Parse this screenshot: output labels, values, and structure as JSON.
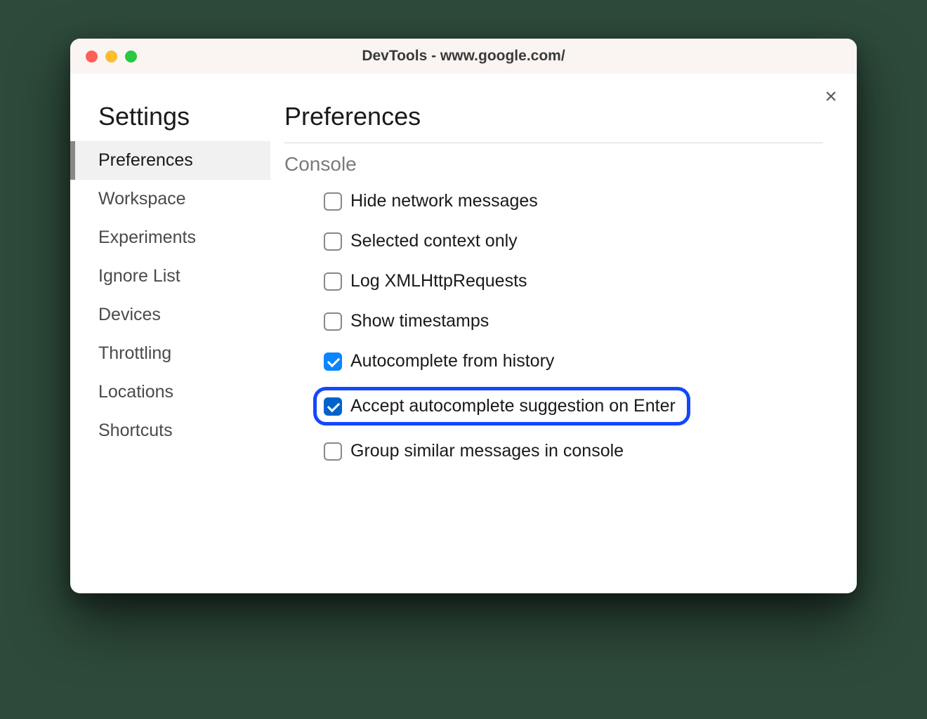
{
  "window": {
    "title": "DevTools - www.google.com/"
  },
  "sidebar": {
    "title": "Settings",
    "items": [
      {
        "label": "Preferences",
        "active": true
      },
      {
        "label": "Workspace",
        "active": false
      },
      {
        "label": "Experiments",
        "active": false
      },
      {
        "label": "Ignore List",
        "active": false
      },
      {
        "label": "Devices",
        "active": false
      },
      {
        "label": "Throttling",
        "active": false
      },
      {
        "label": "Locations",
        "active": false
      },
      {
        "label": "Shortcuts",
        "active": false
      }
    ]
  },
  "main": {
    "title": "Preferences",
    "section": "Console",
    "prefs": [
      {
        "label": "Hide network messages",
        "checked": false,
        "highlighted": false
      },
      {
        "label": "Selected context only",
        "checked": false,
        "highlighted": false
      },
      {
        "label": "Log XMLHttpRequests",
        "checked": false,
        "highlighted": false
      },
      {
        "label": "Show timestamps",
        "checked": false,
        "highlighted": false
      },
      {
        "label": "Autocomplete from history",
        "checked": true,
        "highlighted": false
      },
      {
        "label": "Accept autocomplete suggestion on Enter",
        "checked": true,
        "highlighted": true
      },
      {
        "label": "Group similar messages in console",
        "checked": false,
        "highlighted": false
      }
    ]
  }
}
